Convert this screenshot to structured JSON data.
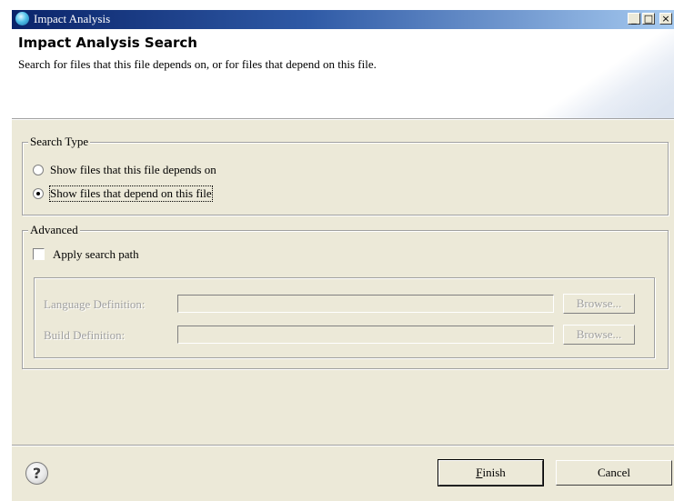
{
  "window": {
    "title": "Impact Analysis",
    "controls": {
      "minimize": "_",
      "maximize": "□",
      "close": "×"
    }
  },
  "header": {
    "title": "Impact Analysis Search",
    "description": "Search for files that this file depends on, or for files that depend on this file."
  },
  "search_type": {
    "legend": "Search Type",
    "options": [
      {
        "label": "Show files that this file depends on",
        "selected": false
      },
      {
        "label": "Show files that depend on this file",
        "selected": true
      }
    ]
  },
  "advanced": {
    "legend": "Advanced",
    "apply_search_path": {
      "label": "Apply search path",
      "checked": false
    },
    "language_definition": {
      "label": "Language Definition:",
      "value": "",
      "browse": "Browse..."
    },
    "build_definition": {
      "label": "Build Definition:",
      "value": "",
      "browse": "Browse..."
    }
  },
  "footer": {
    "help_icon": "help-icon",
    "finish_mnemonic": "F",
    "finish_rest": "inish",
    "cancel": "Cancel"
  }
}
